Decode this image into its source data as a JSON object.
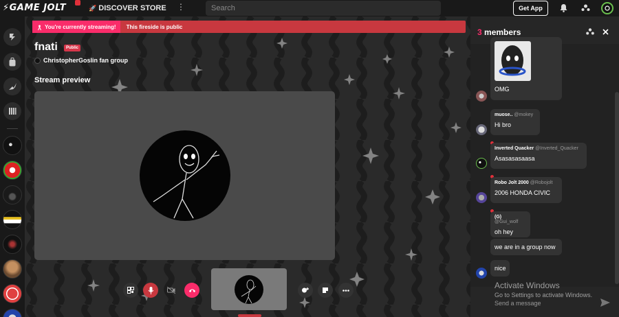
{
  "nav": {
    "logo_text": "GAME JOLT",
    "discover": "DISCOVER",
    "store": "STORE",
    "more": "⋮",
    "search_placeholder": "Search",
    "get_app": "Get App"
  },
  "sidebar": {
    "icons": [
      "jolt-icon",
      "backpack-icon",
      "quest-icon",
      "library-icon"
    ],
    "community_count": 9
  },
  "fireside": {
    "streaming_notice": "You're currently streaming!",
    "public_notice": "This fireside is public",
    "title": "fnati",
    "badge": "Public",
    "group_name": "ChristopherGoslin fan group",
    "preview_label": "Stream preview"
  },
  "chat": {
    "member_count": "3",
    "members_label": " members",
    "messages": [
      {
        "name": "",
        "handle": "",
        "text": "OMG"
      },
      {
        "name": "muose..",
        "handle": "@mokey",
        "text": "Hi bro"
      },
      {
        "name": "Inverted Quacker",
        "handle": "@Inverted_Quacker",
        "text": "Asasasasaasa"
      },
      {
        "name": "Robo Jolt 2000",
        "handle": "@Robojolt",
        "text": "2006 HONDA CIVIC"
      },
      {
        "name": "(G)",
        "handle": "@Gui_wolf",
        "text": "oh hey"
      },
      {
        "name": "",
        "handle": "",
        "text": "we are in a group now"
      },
      {
        "name": "",
        "handle": "",
        "text": "nice"
      }
    ],
    "input_placeholder": "Send a message"
  },
  "windows": {
    "title": "Activate Windows",
    "subtitle": "Go to Settings to activate Windows."
  },
  "colors": {
    "accent": "#fa2c6a",
    "banner_red": "#c8383f",
    "jolt_green": "#6bbf4e"
  }
}
